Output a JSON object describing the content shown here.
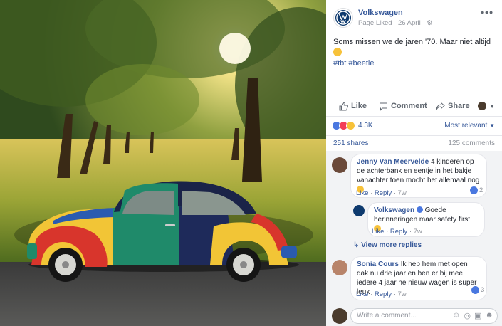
{
  "page": {
    "name": "Volkswagen",
    "liked_label": "Page Liked",
    "dot": "·",
    "date": "26 April",
    "more": "•••"
  },
  "post": {
    "text": "Soms missen we de jaren '70. Maar niet altijd",
    "hashtags": "#tbt #beetle"
  },
  "actions": {
    "like": "Like",
    "comment": "Comment",
    "share": "Share"
  },
  "reactions": {
    "count": "4.3K",
    "sort": "Most relevant",
    "shares": "251 shares",
    "comments": "125 comments",
    "colors": {
      "like": "#4a78e0",
      "love": "#f33e58",
      "haha": "#f7c23a"
    }
  },
  "comments": [
    {
      "author": "Jenny Van Meervelde",
      "text": "4 kinderen op de achterbank en eentje in het bakje vanachter toen mocht het allemaal nog",
      "like": "Like",
      "reply": "Reply",
      "time": "7w",
      "likes": "2"
    },
    {
      "author": "Volkswagen",
      "text": "Goede herinneringen maar safety first!",
      "like": "Like",
      "reply": "Reply",
      "time": "7w"
    },
    {
      "author": "Sonia Cours",
      "text": "Ik heb hem met open dak nu drie jaar en ben er bij mee iedere 4 jaar ne nieuw wagen is super leuk",
      "like": "Like",
      "reply": "Reply",
      "time": "7w",
      "likes": "3"
    }
  ],
  "view_more": "View more replies",
  "write_placeholder": "Write a comment...",
  "brand_color": "#365899"
}
